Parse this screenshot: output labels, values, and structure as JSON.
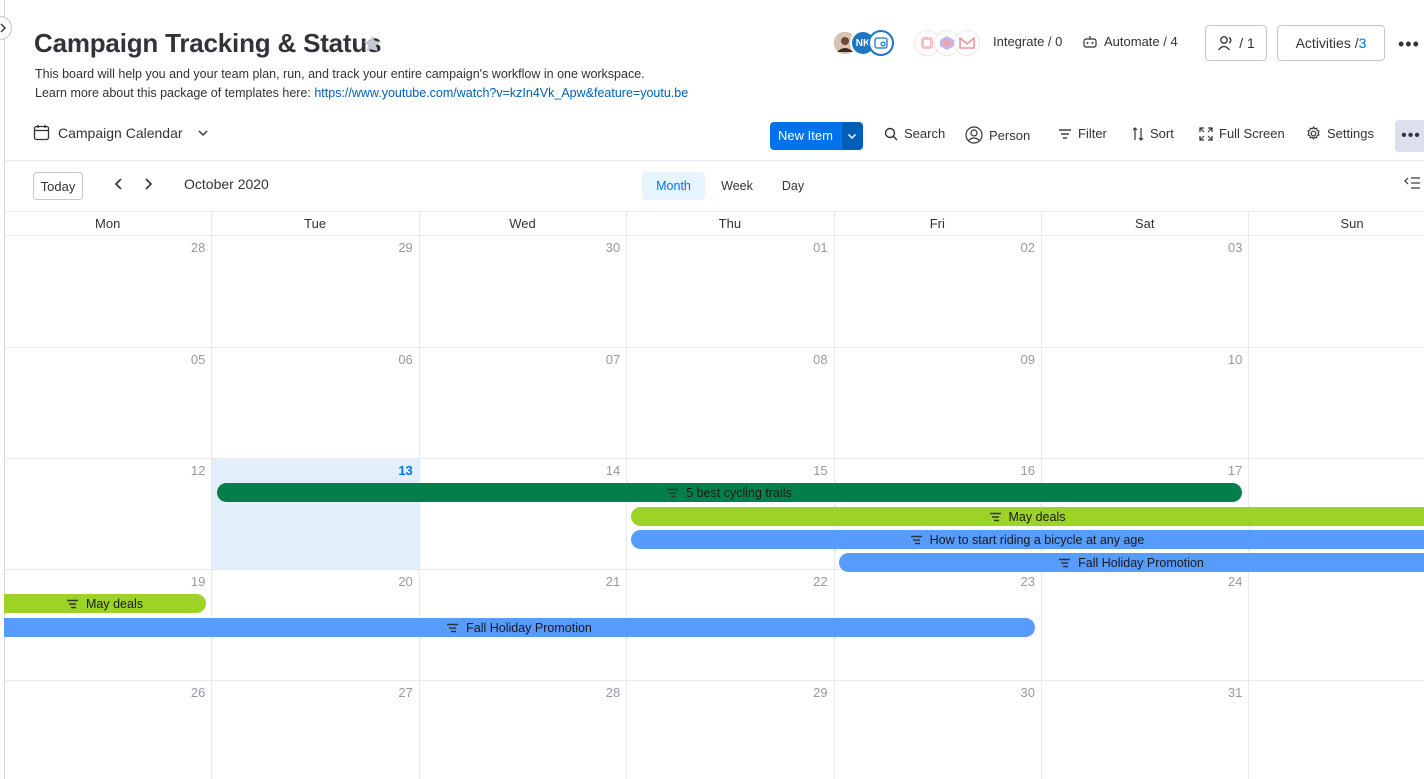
{
  "board": {
    "title": "Campaign Tracking & Status",
    "description_line1": "This board will help you and your team plan, run, and track your entire campaign's workflow in one workspace.",
    "description_line2_prefix": "Learn more about this package of templates here: ",
    "description_link": "https://www.youtube.com/watch?v=kzIn4Vk_Apw&feature=youtu.be"
  },
  "header": {
    "avatar_initials": "NK",
    "integrate_label": "Integrate / 0",
    "automate_label": "Automate / 4",
    "members_label": "/ 1",
    "activities_label": "Activities / ",
    "activities_count": "3",
    "more_label": "•••"
  },
  "toolbar": {
    "view_name": "Campaign Calendar",
    "new_item_label": "New Item",
    "search_label": "Search",
    "person_label": "Person",
    "filter_label": "Filter",
    "sort_label": "Sort",
    "fullscreen_label": "Full Screen",
    "settings_label": "Settings",
    "more_label": "•••"
  },
  "calendar": {
    "today_label": "Today",
    "month_label": "October 2020",
    "view_tabs": [
      "Month",
      "Week",
      "Day"
    ],
    "active_view": "Month",
    "weekdays": [
      "Mon",
      "Tue",
      "Wed",
      "Thu",
      "Fri",
      "Sat",
      "Sun"
    ],
    "weeks": [
      [
        "28",
        "29",
        "30",
        "01",
        "02",
        "03",
        ""
      ],
      [
        "05",
        "06",
        "07",
        "08",
        "09",
        "10",
        ""
      ],
      [
        "12",
        "13",
        "14",
        "15",
        "16",
        "17",
        ""
      ],
      [
        "19",
        "20",
        "21",
        "22",
        "23",
        "24",
        ""
      ],
      [
        "26",
        "27",
        "28",
        "29",
        "30",
        "31",
        ""
      ]
    ],
    "today_date": "13",
    "events": [
      {
        "title": "5 best cycling trails",
        "color": "#037f4c"
      },
      {
        "title": "May deals",
        "color": "#9cd326"
      },
      {
        "title": "How to start riding a bicycle at any age",
        "color": "#579bfc"
      },
      {
        "title": "Fall Holiday Promotion",
        "color": "#579bfc"
      },
      {
        "title": "May deals",
        "color": "#9cd326"
      },
      {
        "title": "Fall Holiday Promotion",
        "color": "#579bfc"
      }
    ]
  }
}
